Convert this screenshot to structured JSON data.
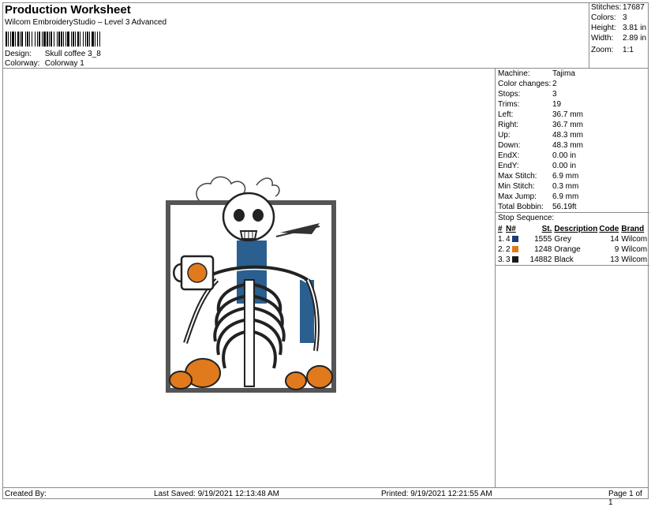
{
  "header": {
    "title": "Production Worksheet",
    "subtitle": "Wilcom EmbroideryStudio – Level 3 Advanced",
    "design_label": "Design:",
    "design_value": "Skull coffee 3_8",
    "colorway_label": "Colorway:",
    "colorway_value": "Colorway 1"
  },
  "stats": [
    {
      "label": "Stitches:",
      "value": "17687"
    },
    {
      "label": "Colors:",
      "value": "3"
    },
    {
      "label": "Height:",
      "value": "3.81 in"
    },
    {
      "label": "Width:",
      "value": "2.89 in"
    },
    {
      "label": "Zoom:",
      "value": "1:1"
    }
  ],
  "machine": [
    {
      "label": "Machine:",
      "value": "Tajima"
    },
    {
      "label": "Color changes:",
      "value": "2"
    },
    {
      "label": "Stops:",
      "value": "3"
    },
    {
      "label": "Trims:",
      "value": "19"
    },
    {
      "label": "Left:",
      "value": "36.7 mm"
    },
    {
      "label": "Right:",
      "value": "36.7 mm"
    },
    {
      "label": "Up:",
      "value": "48.3 mm"
    },
    {
      "label": "Down:",
      "value": "48.3 mm"
    },
    {
      "label": "EndX:",
      "value": "0.00 in"
    },
    {
      "label": "EndY:",
      "value": "0.00 in"
    },
    {
      "label": "Max Stitch:",
      "value": "6.9 mm"
    },
    {
      "label": "Min Stitch:",
      "value": "0.3 mm"
    },
    {
      "label": "Max Jump:",
      "value": "6.9 mm"
    },
    {
      "label": "Total Bobbin:",
      "value": "56.19ft"
    }
  ],
  "stop_sequence": {
    "title": "Stop Sequence:",
    "headers": {
      "num": "#",
      "n": "N#",
      "st": "St.",
      "desc": "Description",
      "code": "Code",
      "brand": "Brand"
    },
    "rows": [
      {
        "num": "1.",
        "n": "4",
        "color": "#1a3d7a",
        "st": "1555",
        "desc": "Grey",
        "code": "14",
        "brand": "Wilcom"
      },
      {
        "num": "2.",
        "n": "2",
        "color": "#e07a1c",
        "st": "1248",
        "desc": "Orange",
        "code": "9",
        "brand": "Wilcom"
      },
      {
        "num": "3.",
        "n": "3",
        "color": "#1a1a1a",
        "st": "14882",
        "desc": "Black",
        "code": "13",
        "brand": "Wilcom"
      }
    ]
  },
  "footer": {
    "created_by": "Created By:",
    "last_saved": "Last Saved: 9/19/2021 12:13:48 AM",
    "printed": "Printed: 9/19/2021 12:21:55 AM",
    "page": "Page 1 of 1"
  }
}
